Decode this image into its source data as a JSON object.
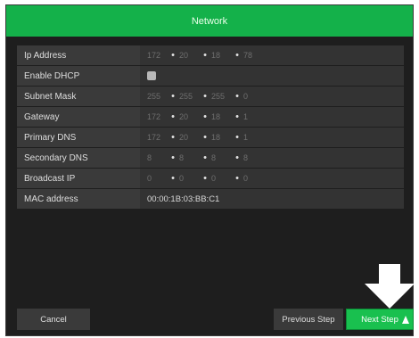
{
  "title": "Network",
  "fields": [
    {
      "label": "Ip Address",
      "octets": [
        "172",
        "20",
        "18",
        "78"
      ]
    },
    {
      "label": "Enable DHCP",
      "checkbox": false
    },
    {
      "label": "Subnet Mask",
      "octets": [
        "255",
        "255",
        "255",
        "0"
      ]
    },
    {
      "label": "Gateway",
      "octets": [
        "172",
        "20",
        "18",
        "1"
      ]
    },
    {
      "label": "Primary DNS",
      "octets": [
        "172",
        "20",
        "18",
        "1"
      ]
    },
    {
      "label": "Secondary DNS",
      "octets": [
        "8",
        "8",
        "8",
        "8"
      ]
    },
    {
      "label": "Broadcast IP",
      "octets": [
        "0",
        "0",
        "0",
        "0"
      ]
    },
    {
      "label": "MAC address",
      "value": "00:00:1B:03:BB:C1"
    }
  ],
  "buttons": {
    "cancel": "Cancel",
    "previous": "Previous Step",
    "next": "Next Step"
  },
  "colors": {
    "accent": "#14b14a",
    "panel": "#1e1e1e",
    "row_label_bg": "#3a3a3a",
    "row_value_bg": "#333333"
  },
  "icons": {
    "arrow": "down-arrow-icon",
    "cursor": "mouse-pointer-icon"
  }
}
